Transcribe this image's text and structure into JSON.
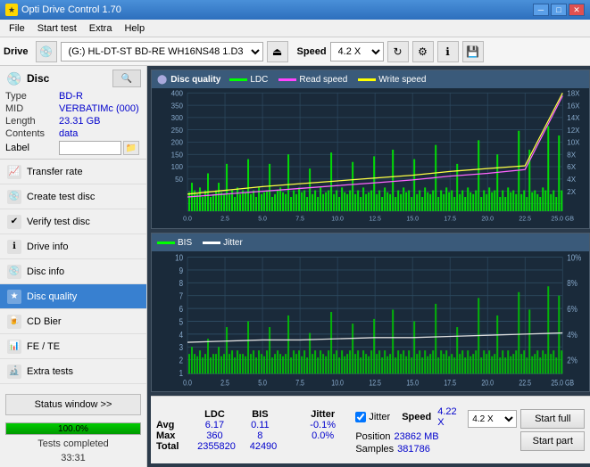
{
  "app": {
    "title": "Opti Drive Control 1.70",
    "icon": "★"
  },
  "title_controls": {
    "minimize": "─",
    "maximize": "□",
    "close": "✕"
  },
  "menu": {
    "items": [
      "File",
      "Start test",
      "Extra",
      "Help"
    ]
  },
  "toolbar": {
    "drive_label": "Drive",
    "drive_value": "(G:)  HL-DT-ST BD-RE  WH16NS48 1.D3",
    "speed_label": "Speed",
    "speed_value": "4.2 X"
  },
  "disc": {
    "title": "Disc",
    "type_label": "Type",
    "type_value": "BD-R",
    "mid_label": "MID",
    "mid_value": "VERBATIMc (000)",
    "length_label": "Length",
    "length_value": "23.31 GB",
    "contents_label": "Contents",
    "contents_value": "data",
    "label_label": "Label",
    "label_value": ""
  },
  "nav_items": [
    {
      "id": "transfer-rate",
      "label": "Transfer rate",
      "icon": "📈"
    },
    {
      "id": "create-test-disc",
      "label": "Create test disc",
      "icon": "💿"
    },
    {
      "id": "verify-test-disc",
      "label": "Verify test disc",
      "icon": "✔"
    },
    {
      "id": "drive-info",
      "label": "Drive info",
      "icon": "ℹ"
    },
    {
      "id": "disc-info",
      "label": "Disc info",
      "icon": "💿"
    },
    {
      "id": "disc-quality",
      "label": "Disc quality",
      "icon": "★",
      "active": true
    },
    {
      "id": "cd-bier",
      "label": "CD Bier",
      "icon": "🍺"
    },
    {
      "id": "fe-te",
      "label": "FE / TE",
      "icon": "📊"
    },
    {
      "id": "extra-tests",
      "label": "Extra tests",
      "icon": "🔬"
    }
  ],
  "status_btn": "Status window >>",
  "progress": {
    "value": 100,
    "text": "100.0%"
  },
  "status_text": "Tests completed",
  "chart_top": {
    "title": "Disc quality",
    "legend": [
      {
        "label": "LDC",
        "color": "#00ff00"
      },
      {
        "label": "Read speed",
        "color": "#ff44ff"
      },
      {
        "label": "Write speed",
        "color": "#ffff00"
      }
    ],
    "y_max": 400,
    "y_labels_left": [
      "400",
      "350",
      "300",
      "250",
      "200",
      "150",
      "100",
      "50"
    ],
    "y_labels_right": [
      "18X",
      "16X",
      "14X",
      "12X",
      "10X",
      "8X",
      "6X",
      "4X",
      "2X"
    ],
    "x_labels": [
      "0.0",
      "2.5",
      "5.0",
      "7.5",
      "10.0",
      "12.5",
      "15.0",
      "17.5",
      "20.0",
      "22.5",
      "25.0 GB"
    ]
  },
  "chart_bottom": {
    "legend": [
      {
        "label": "BIS",
        "color": "#00ff00"
      },
      {
        "label": "Jitter",
        "color": "#ffffff"
      }
    ],
    "y_labels_left": [
      "10",
      "9",
      "8",
      "7",
      "6",
      "5",
      "4",
      "3",
      "2",
      "1"
    ],
    "y_labels_right": [
      "10%",
      "8%",
      "6%",
      "4%",
      "2%"
    ],
    "x_labels": [
      "0.0",
      "2.5",
      "5.0",
      "7.5",
      "10.0",
      "12.5",
      "15.0",
      "17.5",
      "20.0",
      "22.5",
      "25.0 GB"
    ]
  },
  "stats": {
    "headers": [
      "",
      "LDC",
      "BIS",
      "",
      "Jitter",
      "Speed",
      ""
    ],
    "avg_label": "Avg",
    "avg_ldc": "6.17",
    "avg_bis": "0.11",
    "avg_jitter": "-0.1%",
    "max_label": "Max",
    "max_ldc": "360",
    "max_bis": "8",
    "max_jitter": "0.0%",
    "total_label": "Total",
    "total_ldc": "2355820",
    "total_bis": "42490",
    "jitter_checked": true,
    "jitter_label": "Jitter",
    "speed_label": "Speed",
    "speed_value": "4.22 X",
    "position_label": "Position",
    "position_value": "23862 MB",
    "samples_label": "Samples",
    "samples_value": "381786",
    "speed_select": "4.2 X",
    "start_full_label": "Start full",
    "start_part_label": "Start part"
  }
}
